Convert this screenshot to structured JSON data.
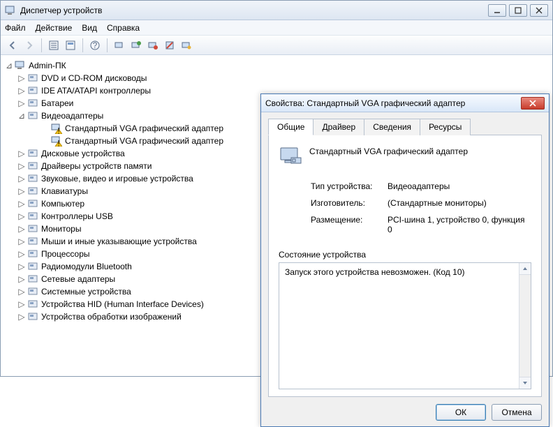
{
  "window": {
    "title": "Диспетчер устройств"
  },
  "menu": {
    "file": "Файл",
    "action": "Действие",
    "view": "Вид",
    "help": "Справка"
  },
  "tree": {
    "root": "Admin-ПК",
    "items": [
      {
        "label": "DVD и CD-ROM дисководы",
        "expandable": true
      },
      {
        "label": "IDE ATA/ATAPI контроллеры",
        "expandable": true
      },
      {
        "label": "Батареи",
        "expandable": true
      },
      {
        "label": "Видеоадаптеры",
        "expandable": true,
        "expanded": true,
        "children": [
          {
            "label": "Стандартный VGA графический адаптер",
            "warn": true
          },
          {
            "label": "Стандартный VGA графический адаптер",
            "warn": true
          }
        ]
      },
      {
        "label": "Дисковые устройства",
        "expandable": true
      },
      {
        "label": "Драйверы устройств памяти",
        "expandable": true
      },
      {
        "label": "Звуковые, видео и игровые устройства",
        "expandable": true
      },
      {
        "label": "Клавиатуры",
        "expandable": true
      },
      {
        "label": "Компьютер",
        "expandable": true
      },
      {
        "label": "Контроллеры USB",
        "expandable": true
      },
      {
        "label": "Мониторы",
        "expandable": true
      },
      {
        "label": "Мыши и иные указывающие устройства",
        "expandable": true
      },
      {
        "label": "Процессоры",
        "expandable": true
      },
      {
        "label": "Радиомодули Bluetooth",
        "expandable": true
      },
      {
        "label": "Сетевые адаптеры",
        "expandable": true
      },
      {
        "label": "Системные устройства",
        "expandable": true
      },
      {
        "label": "Устройства HID (Human Interface Devices)",
        "expandable": true
      },
      {
        "label": "Устройства обработки изображений",
        "expandable": true
      }
    ]
  },
  "dialog": {
    "title": "Свойства: Стандартный VGA графический адаптер",
    "tabs": {
      "general": "Общие",
      "driver": "Драйвер",
      "details": "Сведения",
      "resources": "Ресурсы"
    },
    "device_name": "Стандартный VGA графический адаптер",
    "fields": {
      "type_label": "Тип устройства:",
      "type_value": "Видеоадаптеры",
      "manufacturer_label": "Изготовитель:",
      "manufacturer_value": "(Стандартные мониторы)",
      "location_label": "Размещение:",
      "location_value": "PCI-шина 1, устройство 0, функция 0"
    },
    "state_label": "Состояние устройства",
    "state_text": "Запуск этого устройства невозможен. (Код 10)",
    "ok": "ОК",
    "cancel": "Отмена"
  }
}
